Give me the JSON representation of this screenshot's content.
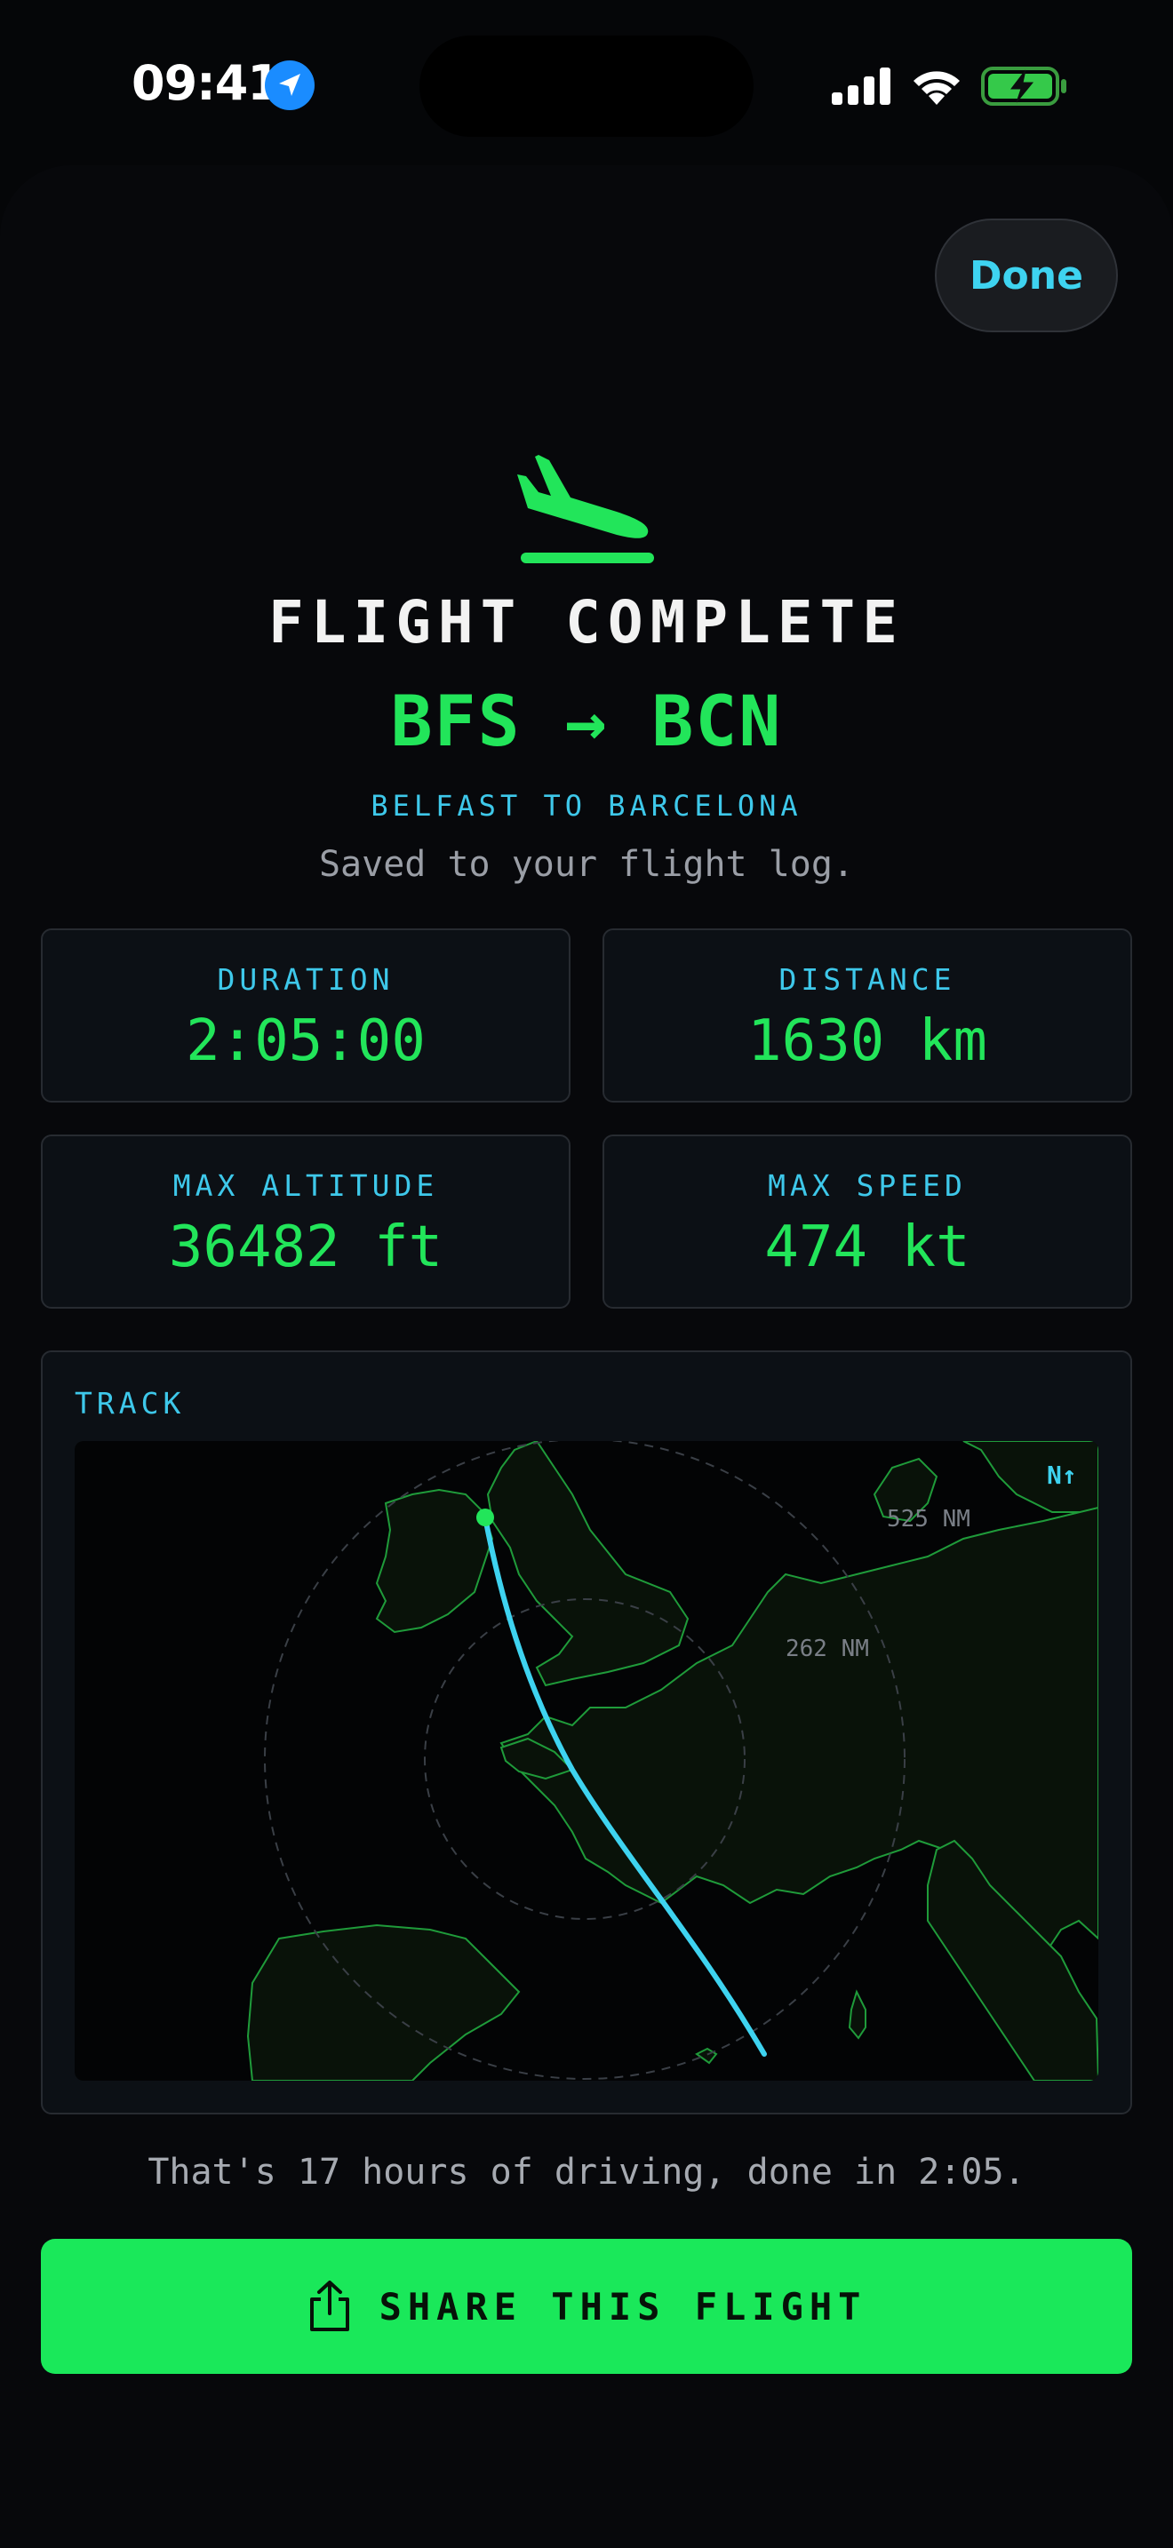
{
  "status_bar": {
    "time": "09:41",
    "icons": [
      "location-arrow-icon",
      "cellular-signal-icon",
      "wifi-icon",
      "battery-charging-icon"
    ]
  },
  "header": {
    "done_label": "Done",
    "icon": "airplane-landing-icon",
    "title": "FLIGHT COMPLETE",
    "route": "BFS → BCN",
    "route_subtitle": "BELFAST TO BARCELONA",
    "saved_text": "Saved to your flight log."
  },
  "stats": [
    {
      "label": "DURATION",
      "value": "2:05:00"
    },
    {
      "label": "DISTANCE",
      "value": "1630 km"
    },
    {
      "label": "MAX ALTITUDE",
      "value": "36482 ft"
    },
    {
      "label": "MAX SPEED",
      "value": "474 kt"
    }
  ],
  "track": {
    "label": "TRACK",
    "north_label": "N↑",
    "ring_inner_label": "262 NM",
    "ring_outer_label": "525 NM"
  },
  "driving_text": "That's 17 hours of driving, done in 2:05.",
  "share": {
    "label": "SHARE THIS FLIGHT",
    "icon": "share-icon"
  },
  "colors": {
    "accent_green": "#1ae85a",
    "accent_cyan": "#3ec8ea",
    "background": "#050608",
    "card": "#0c1015"
  }
}
